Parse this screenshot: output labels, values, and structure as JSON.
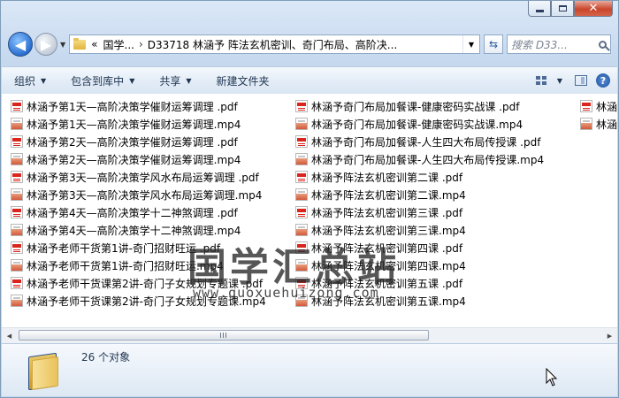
{
  "address": {
    "overflow": "«",
    "crumbs": [
      "国学...",
      "D33718 林涵予 阵法玄机密训、奇门布局、高阶决..."
    ]
  },
  "search": {
    "placeholder": "搜索 D33..."
  },
  "toolbar": {
    "organize": "组织",
    "include_library": "包含到库中",
    "share": "共享",
    "new_folder": "新建文件夹"
  },
  "columns": [
    [
      {
        "name": "林涵予第1天—高阶决策学催财运筹调理 .pdf",
        "type": "pdf"
      },
      {
        "name": "林涵予第1天—高阶决策学催财运筹调理.mp4",
        "type": "mp4"
      },
      {
        "name": "林涵予第2天—高阶决策学催财运筹调理 .pdf",
        "type": "pdf"
      },
      {
        "name": "林涵予第2天—高阶决策学催财运筹调理.mp4",
        "type": "mp4"
      },
      {
        "name": "林涵予第3天—高阶决策学风水布局运筹调理 .pdf",
        "type": "pdf"
      },
      {
        "name": "林涵予第3天—高阶决策学风水布局运筹调理.mp4",
        "type": "mp4"
      },
      {
        "name": "林涵予第4天—高阶决策学十二神煞调理 .pdf",
        "type": "pdf"
      },
      {
        "name": "林涵予第4天—高阶决策学十二神煞调理.mp4",
        "type": "mp4"
      },
      {
        "name": "林涵予老师干货第1讲-奇门招财旺运 .pdf",
        "type": "pdf"
      },
      {
        "name": "林涵予老师干货第1讲-奇门招财旺运.mp4",
        "type": "mp4"
      },
      {
        "name": "林涵予老师干货课第2讲-奇门子女规划专题课 .pdf",
        "type": "pdf"
      },
      {
        "name": "林涵予老师干货课第2讲-奇门子女规划专题课.mp4",
        "type": "mp4"
      }
    ],
    [
      {
        "name": "林涵予奇门布局加餐课-健康密码实战课 .pdf",
        "type": "pdf"
      },
      {
        "name": "林涵予奇门布局加餐课-健康密码实战课.mp4",
        "type": "mp4"
      },
      {
        "name": "林涵予奇门布局加餐课-人生四大布局传授课 .pdf",
        "type": "pdf"
      },
      {
        "name": "林涵予奇门布局加餐课-人生四大布局传授课.mp4",
        "type": "mp4"
      },
      {
        "name": "林涵予阵法玄机密训第二课 .pdf",
        "type": "pdf"
      },
      {
        "name": "林涵予阵法玄机密训第二课.mp4",
        "type": "mp4"
      },
      {
        "name": "林涵予阵法玄机密训第三课 .pdf",
        "type": "pdf"
      },
      {
        "name": "林涵予阵法玄机密训第三课.mp4",
        "type": "mp4"
      },
      {
        "name": "林涵予阵法玄机密训第四课 .pdf",
        "type": "pdf"
      },
      {
        "name": "林涵予阵法玄机密训第四课.mp4",
        "type": "mp4"
      },
      {
        "name": "林涵予阵法玄机密训第五课 .pdf",
        "type": "pdf"
      },
      {
        "name": "林涵予阵法玄机密训第五课.mp4",
        "type": "mp4"
      }
    ],
    [
      {
        "name": "林涵",
        "type": "pdf"
      },
      {
        "name": "林涵",
        "type": "mp4"
      }
    ]
  ],
  "watermark": {
    "title": "国学汇总站",
    "url": "www.guoxuehuizong.com"
  },
  "status": {
    "count": "26 个对象"
  }
}
